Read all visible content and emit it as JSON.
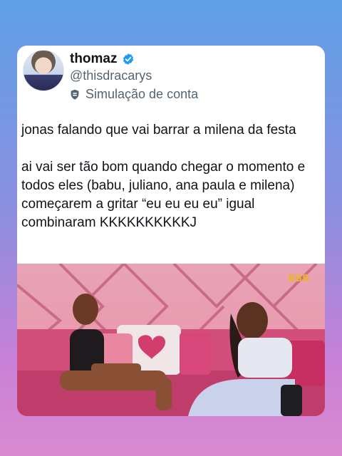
{
  "tweet": {
    "display_name": "thomaz",
    "handle": "@thisdracarys",
    "label": "Simulação de conta",
    "paragraphs": [
      "jonas falando que vai barrar a milena da festa",
      "ai vai ser tão bom quando chegar o momento e todos eles (babu, juliano, ana paula e milena) começarem a gritar “eu eu eu eu” igual combinaram KKKKKKKKKKJ"
    ]
  },
  "media": {
    "logo_text": "BBB"
  },
  "icons": {
    "verified": "verified-badge-icon",
    "label": "shield-icon"
  },
  "colors": {
    "verified": "#1d9bf0",
    "handle_gray": "#536471",
    "text": "#0f1419"
  }
}
